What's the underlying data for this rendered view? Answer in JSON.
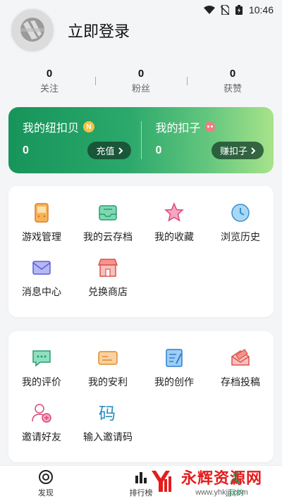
{
  "status_bar": {
    "time": "10:46"
  },
  "header": {
    "login_text": "立即登录"
  },
  "stats": [
    {
      "num": "0",
      "label": "关注"
    },
    {
      "num": "0",
      "label": "粉丝"
    },
    {
      "num": "0",
      "label": "获赞"
    }
  ],
  "wallet": {
    "left": {
      "title": "我的纽扣贝",
      "coin_letter": "N",
      "amount": "0",
      "button": "充值"
    },
    "right": {
      "title": "我的扣子",
      "amount": "0",
      "button": "赚扣子"
    }
  },
  "grid1": [
    {
      "label": "游戏管理",
      "icon": "game-manage-icon"
    },
    {
      "label": "我的云存档",
      "icon": "cloud-save-icon"
    },
    {
      "label": "我的收藏",
      "icon": "star-icon"
    },
    {
      "label": "浏览历史",
      "icon": "clock-icon"
    },
    {
      "label": "消息中心",
      "icon": "mail-icon"
    },
    {
      "label": "兑换商店",
      "icon": "store-icon"
    }
  ],
  "grid2": [
    {
      "label": "我的评价",
      "icon": "comment-icon"
    },
    {
      "label": "我的安利",
      "icon": "card-icon"
    },
    {
      "label": "我的创作",
      "icon": "edit-icon"
    },
    {
      "label": "存档投稿",
      "icon": "envelope-upload-icon"
    },
    {
      "label": "邀请好友",
      "icon": "add-user-icon"
    },
    {
      "label": "输入邀请码",
      "icon": "code-icon"
    }
  ],
  "tabbar": [
    {
      "label": "发现"
    },
    {
      "label": "排行榜"
    },
    {
      "label": "我的"
    }
  ],
  "watermark": {
    "title": "永辉资源网",
    "url": "www.yhkjjj.com"
  },
  "colors": {
    "accent": "#22b573",
    "wallet_start": "#17945a",
    "wallet_end": "#a8e38a"
  }
}
